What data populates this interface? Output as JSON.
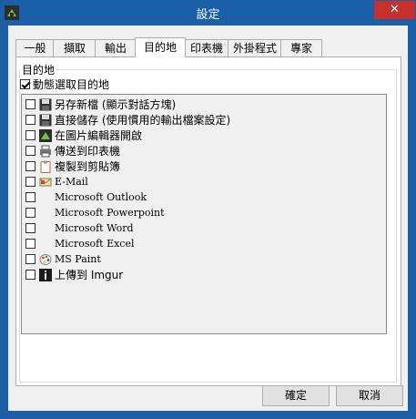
{
  "window": {
    "title": "設定",
    "close_glyph": "✕"
  },
  "tabs": [
    {
      "label": "一般",
      "active": false
    },
    {
      "label": "擷取",
      "active": false
    },
    {
      "label": "輸出",
      "active": false
    },
    {
      "label": "目的地",
      "active": true
    },
    {
      "label": "印表機",
      "active": false
    },
    {
      "label": "外掛程式",
      "active": false
    },
    {
      "label": "專家",
      "active": false
    }
  ],
  "destination": {
    "group_label": "目的地",
    "auto_select_label": "動態選取目的地",
    "auto_select_checked": true,
    "items": [
      {
        "label": "另存新檔 (顯示對話方塊)",
        "icon": "floppy-disk-icon",
        "checked": false
      },
      {
        "label": "直接儲存 (使用慣用的輸出檔案設定)",
        "icon": "floppy-disk-icon",
        "checked": false
      },
      {
        "label": "在圖片編輯器開啟",
        "icon": "greenshot-icon",
        "checked": false
      },
      {
        "label": "傳送到印表機",
        "icon": "printer-icon",
        "checked": false
      },
      {
        "label": "複製到剪貼簿",
        "icon": "clipboard-icon",
        "checked": false
      },
      {
        "label": "E-Mail",
        "icon": "email-icon",
        "checked": false
      },
      {
        "label": "Microsoft Outlook",
        "icon": "none",
        "checked": false
      },
      {
        "label": "Microsoft Powerpoint",
        "icon": "none",
        "checked": false
      },
      {
        "label": "Microsoft Word",
        "icon": "none",
        "checked": false
      },
      {
        "label": "Microsoft Excel",
        "icon": "none",
        "checked": false
      },
      {
        "label": "MS Paint",
        "icon": "paint-palette-icon",
        "checked": false
      },
      {
        "label": "上傳到 Imgur",
        "icon": "imgur-icon",
        "checked": false
      }
    ]
  },
  "buttons": {
    "ok": "確定",
    "cancel": "取消"
  }
}
